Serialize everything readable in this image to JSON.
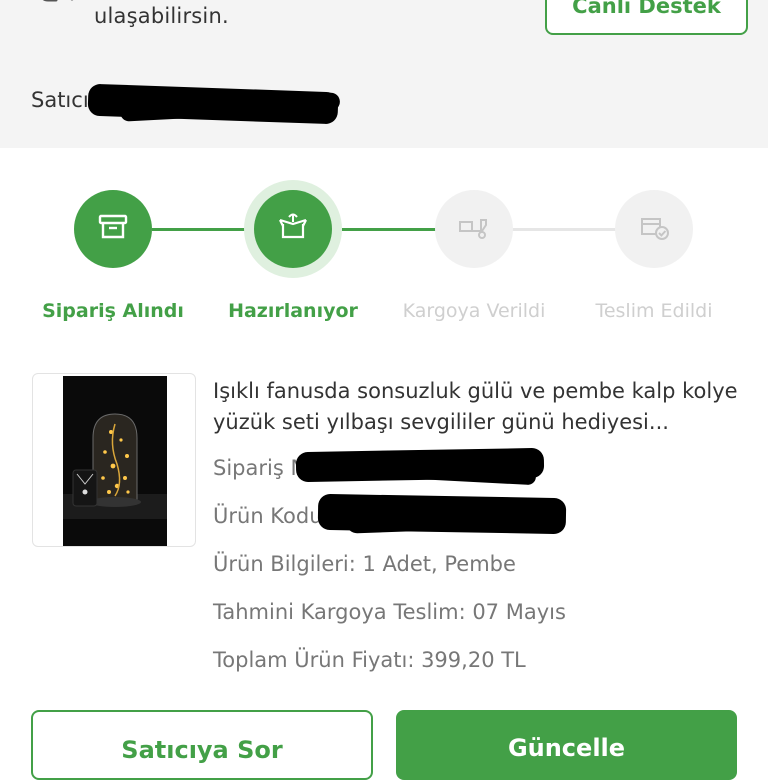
{
  "help": {
    "text": "ulaşabilirsin.",
    "live_support_label": "Canlı Destek"
  },
  "seller": {
    "prefix": "Satıcı:",
    "name": "B"
  },
  "steps": [
    {
      "label": "Sipariş Alındı",
      "status": "done",
      "icon": "archive-box-icon"
    },
    {
      "label": "Hazırlanıyor",
      "status": "done",
      "icon": "open-box-icon"
    },
    {
      "label": "Kargoya Verildi",
      "status": "todo",
      "icon": "delivery-truck-icon"
    },
    {
      "label": "Teslim Edildi",
      "status": "todo",
      "icon": "box-check-icon"
    }
  ],
  "product": {
    "title": "Işıklı fanusda sonsuzluk gülü ve pembe kalp kolye yüzük seti yılbaşı sevgililer günü hediyesi...",
    "order_no_label": "Sipariş N",
    "product_code_label": "Ürün Kodu:",
    "product_info": "Ürün Bilgileri: 1 Adet, Pembe",
    "estimated_shipping": "Tahmini Kargoya Teslim: 07 Mayıs",
    "total_price": "Toplam Ürün Fiyatı: 399,20 TL"
  },
  "actions": {
    "ask_seller": "Satıcıya Sor",
    "update": "Güncelle"
  },
  "colors": {
    "accent": "#43a047",
    "inactive": "#cfcfcf",
    "link": "#2e73b8"
  }
}
